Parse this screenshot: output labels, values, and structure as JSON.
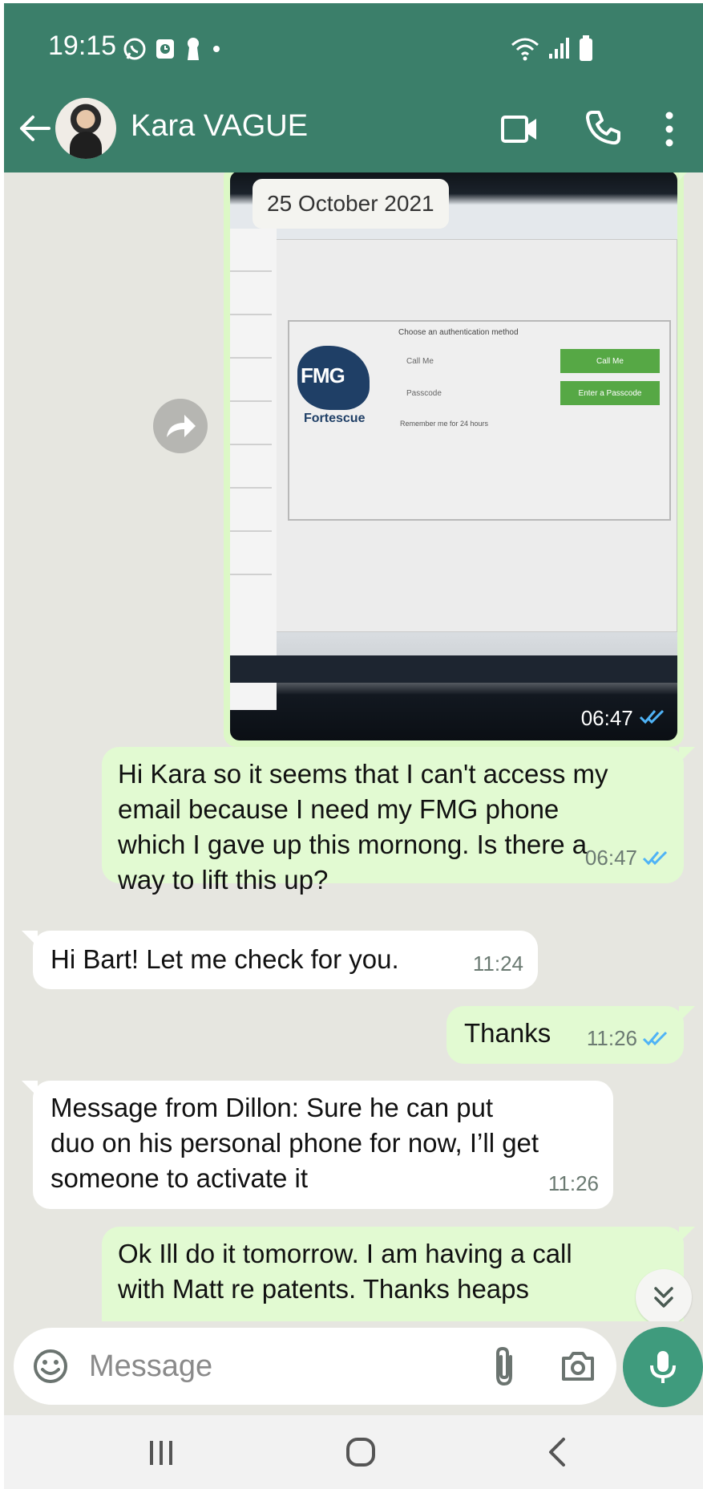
{
  "status_bar": {
    "time": "19:15"
  },
  "header": {
    "contact_name": "Kara VAGUE"
  },
  "date_chip": "25 October 2021",
  "messages": [
    {
      "direction": "outgoing",
      "type": "image",
      "time": "06:47",
      "status": "read",
      "image_text": {
        "auth_title": "Choose an authentication method",
        "option_call": "Call Me",
        "option_passcode": "Passcode",
        "button_call": "Call Me",
        "button_passcode": "Enter a Passcode",
        "remember": "Remember me for 24 hours",
        "logo": "FMG",
        "brand": "Fortescue"
      }
    },
    {
      "direction": "outgoing",
      "type": "text",
      "time": "06:47",
      "status": "read",
      "text": "Hi Kara so it seems that I can't access my email because I need my FMG phone which I gave up this mornong. Is there a way to lift this up?"
    },
    {
      "direction": "incoming",
      "type": "text",
      "time": "11:24",
      "text": "Hi Bart! Let me check for you."
    },
    {
      "direction": "outgoing",
      "type": "text",
      "time": "11:26",
      "status": "read",
      "text": "Thanks"
    },
    {
      "direction": "incoming",
      "type": "text",
      "time": "11:26",
      "text": "Message from Dillon: Sure he can put duo on his personal phone for now, I’ll get someone to activate it"
    },
    {
      "direction": "outgoing",
      "type": "text",
      "text": "Ok Ill do it tomorrow. I am having a call with Matt re patents. Thanks heaps"
    }
  ],
  "composer": {
    "placeholder": "Message"
  },
  "colors": {
    "header": "#3b7f6a",
    "chat_background": "#e6e6e0",
    "outgoing_bubble": "#e2fad2",
    "incoming_bubble": "#ffffff",
    "read_ticks": "#4fb3f6",
    "mic_button": "#3f9b7d"
  },
  "icons": [
    "whatsapp-icon",
    "clock-icon",
    "keyhole-icon",
    "wifi-icon",
    "signal-icon",
    "battery-icon",
    "back-arrow-icon",
    "video-call-icon",
    "phone-icon",
    "more-vert-icon",
    "forward-icon",
    "double-check-icon",
    "chevrons-down-icon",
    "emoji-icon",
    "paperclip-icon",
    "camera-icon",
    "mic-icon",
    "nav-recents-icon",
    "nav-home-icon",
    "nav-back-icon"
  ]
}
